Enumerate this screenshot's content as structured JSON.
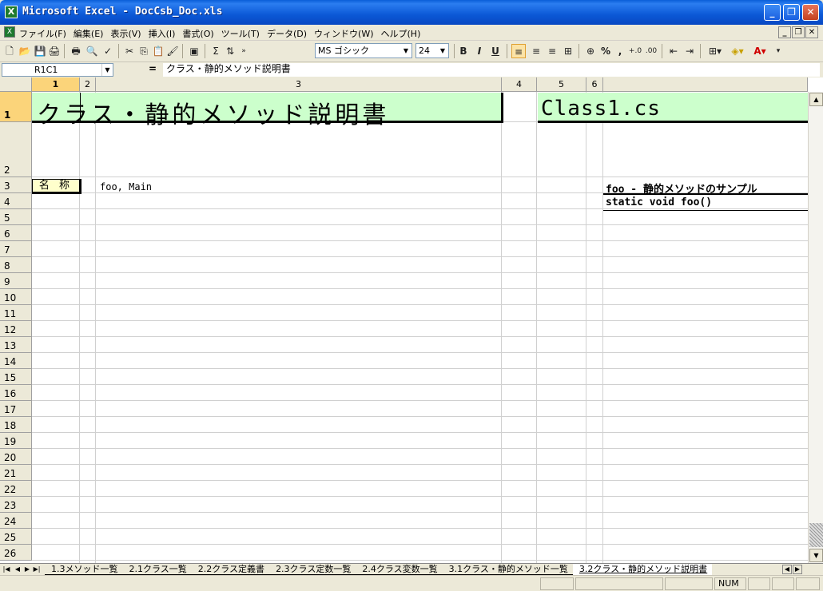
{
  "window": {
    "title": "Microsoft Excel - DocCsb_Doc.xls",
    "app_icon_glyph": "X",
    "minimize_glyph": "_",
    "maximize_glyph": "❐",
    "close_glyph": "✕"
  },
  "menubar": {
    "items": [
      "ファイル(F)",
      "編集(E)",
      "表示(V)",
      "挿入(I)",
      "書式(O)",
      "ツール(T)",
      "データ(D)",
      "ウィンドウ(W)",
      "ヘルプ(H)"
    ],
    "doc_min": "_",
    "doc_restore": "❐",
    "doc_close": "✕"
  },
  "toolbar": {
    "font_name": "MS ゴシック",
    "font_size": "24",
    "bold": "B",
    "italic": "I",
    "underline": "U",
    "sum": "Σ",
    "percent": "%",
    "comma": ","
  },
  "formula_bar": {
    "name_box": "R1C1",
    "fx": "=",
    "value": "クラス・静的メソッド説明書"
  },
  "sheet": {
    "columns": [
      "1",
      "2",
      "3",
      "4",
      "5",
      "6"
    ],
    "rows": [
      "1",
      "2",
      "3",
      "4",
      "5",
      "6",
      "7",
      "8",
      "9",
      "10",
      "11",
      "12",
      "13",
      "14",
      "15",
      "16",
      "17",
      "18",
      "19",
      "20",
      "21",
      "22",
      "23",
      "24",
      "25",
      "26"
    ],
    "title": "クラス・静的メソッド説明書",
    "class_name": "Class1.cs",
    "name_label": "名 称",
    "name_value": "foo, Main",
    "method_title": "foo - 静的メソッドのサンプル",
    "method_signature": "static void foo()"
  },
  "tabs": {
    "items": [
      "1.3メソッド一覧",
      "2.1クラス一覧",
      "2.2クラス定義書",
      "2.3クラス定数一覧",
      "2.4クラス変数一覧",
      "3.1クラス・静的メソッド一覧",
      "3.2クラス・静的メソッド説明書"
    ],
    "active_index": 6
  },
  "statusbar": {
    "num": "NUM"
  }
}
